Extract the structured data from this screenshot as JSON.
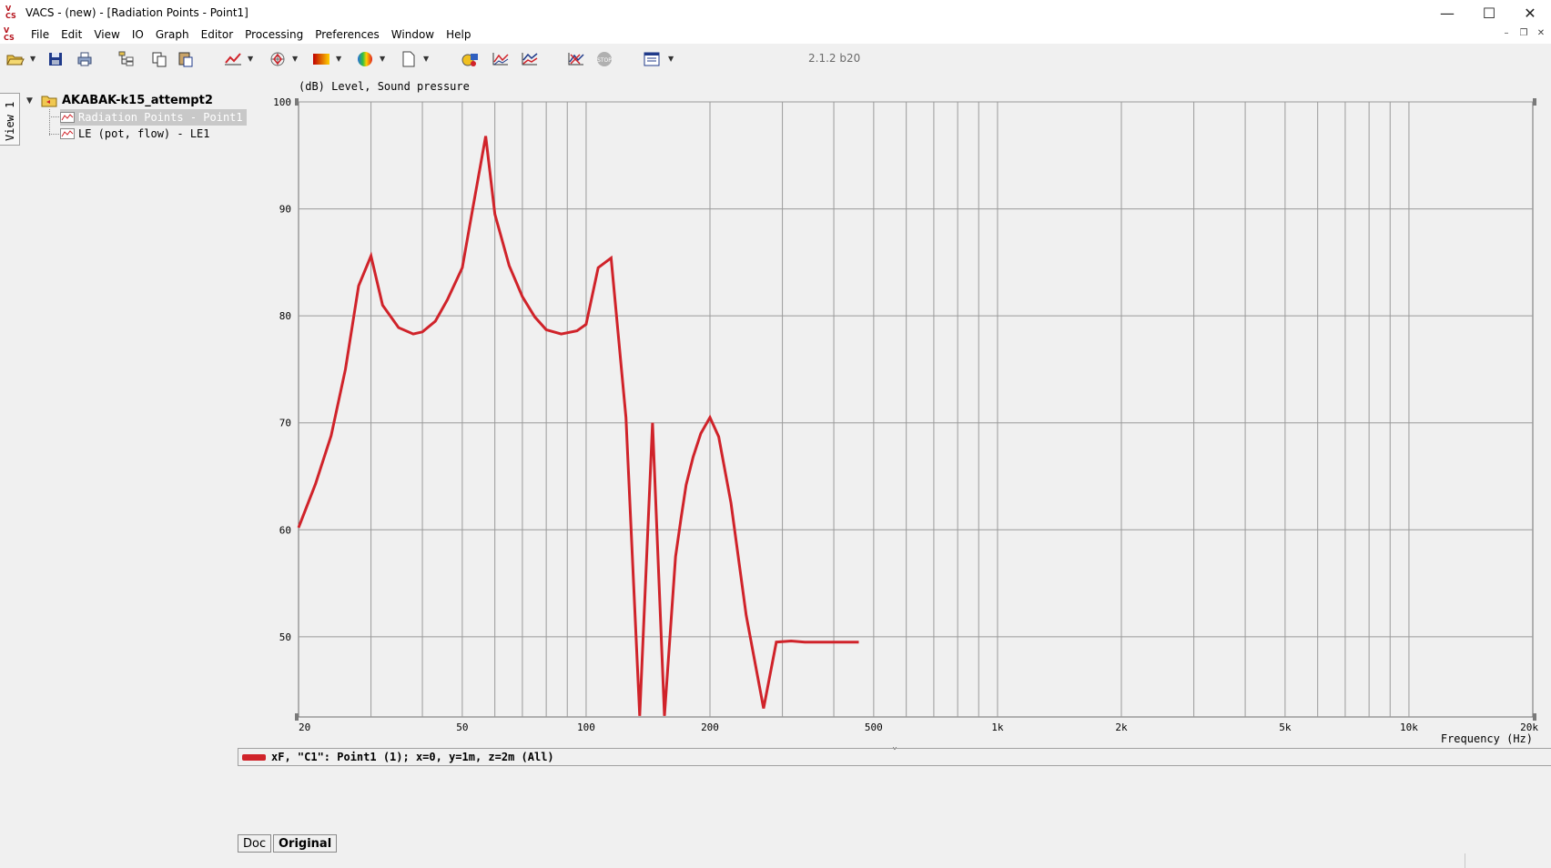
{
  "window": {
    "title": "VACS - (new) - [Radiation Points - Point1]",
    "minimize": "—",
    "maximize": "☐",
    "close": "✕"
  },
  "menu": [
    "File",
    "Edit",
    "View",
    "IO",
    "Graph",
    "Editor",
    "Processing",
    "Preferences",
    "Window",
    "Help"
  ],
  "mdi": {
    "minimize": "–",
    "restore": "❐",
    "close": "✕"
  },
  "toolbar": {
    "version": "2.1.2 b20",
    "icons": [
      "open-folder-icon",
      "save-icon",
      "print-icon",
      "tree-view-icon",
      "copy-icon",
      "paste-icon",
      "line-graph-icon",
      "polar-graph-icon",
      "color-map-icon",
      "sphere-icon",
      "new-document-icon",
      "image-export-icon",
      "graph-export-icon",
      "graph-overlay-icon",
      "graph-settings-icon",
      "stop-icon",
      "window-layout-icon"
    ]
  },
  "side_tab": {
    "label": "View 1"
  },
  "tree": {
    "root": "AKABAK-k15_attempt2",
    "children": [
      {
        "label": "Radiation Points - Point1",
        "selected": true
      },
      {
        "label": "LE (pot, flow) - LE1",
        "selected": false
      }
    ]
  },
  "chart_data": {
    "type": "line",
    "ylabel": "(dB)  Level, Sound pressure",
    "xlabel": "Frequency  (Hz)",
    "x_scale": "log",
    "xlim": [
      20,
      20000
    ],
    "ylim": [
      42.5,
      100
    ],
    "y_ticks": [
      50,
      60,
      70,
      80,
      90,
      100
    ],
    "x_ticks": [
      {
        "v": 20,
        "label": "20"
      },
      {
        "v": 50,
        "label": "50"
      },
      {
        "v": 100,
        "label": "100"
      },
      {
        "v": 200,
        "label": "200"
      },
      {
        "v": 500,
        "label": "500"
      },
      {
        "v": 1000,
        "label": "1k"
      },
      {
        "v": 2000,
        "label": "2k"
      },
      {
        "v": 5000,
        "label": "5k"
      },
      {
        "v": 10000,
        "label": "10k"
      },
      {
        "v": 20000,
        "label": "20k"
      }
    ],
    "grid": true,
    "line_color": "#d0232a",
    "series": [
      {
        "name": "xF, \"C1\": Point1 (1); x=0, y=1m, z=2m  (All)",
        "x": [
          20,
          22,
          24,
          26,
          28,
          30,
          32,
          35,
          38,
          40,
          43,
          46,
          50,
          53,
          57,
          60,
          65,
          70,
          75,
          80,
          87,
          95,
          100,
          107,
          115,
          125,
          135,
          145,
          155,
          165,
          170,
          175,
          182,
          190,
          200,
          210,
          225,
          245,
          270,
          290,
          315,
          340,
          380,
          420,
          460
        ],
        "values": [
          60.2,
          64.3,
          68.8,
          75.0,
          82.8,
          85.6,
          81.0,
          78.9,
          78.3,
          78.5,
          79.5,
          81.5,
          84.5,
          90.0,
          96.8,
          89.5,
          84.7,
          81.8,
          79.9,
          78.7,
          78.3,
          78.6,
          79.2,
          84.5,
          85.4,
          70.5,
          42.6,
          70.0,
          42.6,
          57.5,
          61.0,
          64.2,
          66.8,
          69.0,
          70.5,
          68.7,
          62.5,
          52.0,
          43.3,
          49.5,
          49.6,
          49.5,
          49.5,
          49.5,
          49.5
        ]
      }
    ]
  },
  "legend": {
    "text": "xF, \"C1\": Point1 (1); x=0, y=1m, z=2m  (All)"
  },
  "bottom_tabs": [
    "Doc",
    "Original"
  ]
}
